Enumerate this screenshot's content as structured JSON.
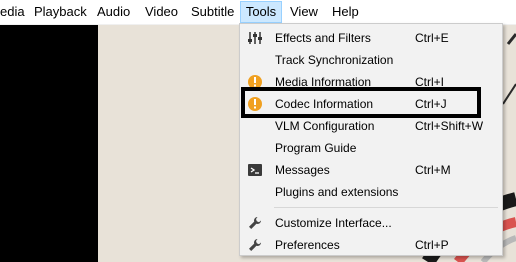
{
  "menubar": {
    "items": [
      {
        "label": "edia"
      },
      {
        "label": "Playback"
      },
      {
        "label": "Audio"
      },
      {
        "label": "Video"
      },
      {
        "label": "Subtitle"
      },
      {
        "label": "Tools",
        "active": true
      },
      {
        "label": "View"
      },
      {
        "label": "Help"
      }
    ]
  },
  "tools_menu": {
    "items": [
      {
        "label": "Effects and Filters",
        "shortcut": "Ctrl+E",
        "icon": "sliders-icon"
      },
      {
        "label": "Track Synchronization",
        "shortcut": "",
        "icon": ""
      },
      {
        "label": "Media Information",
        "shortcut": "Ctrl+I",
        "icon": "info-icon"
      },
      {
        "label": "Codec Information",
        "shortcut": "Ctrl+J",
        "icon": "info-icon"
      },
      {
        "label": "VLM Configuration",
        "shortcut": "Ctrl+Shift+W",
        "icon": ""
      },
      {
        "label": "Program Guide",
        "shortcut": "",
        "icon": ""
      },
      {
        "label": "Messages",
        "shortcut": "Ctrl+M",
        "icon": "terminal-icon"
      },
      {
        "label": "Plugins and extensions",
        "shortcut": "",
        "icon": ""
      },
      {
        "label": "Customize Interface...",
        "shortcut": "",
        "icon": "wrench-icon"
      },
      {
        "label": "Preferences",
        "shortcut": "Ctrl+P",
        "icon": "wrench-icon"
      }
    ]
  },
  "colors": {
    "menu_active_bg": "#cce8ff",
    "info_icon": "#f0a020",
    "highlight_border": "#000000"
  }
}
